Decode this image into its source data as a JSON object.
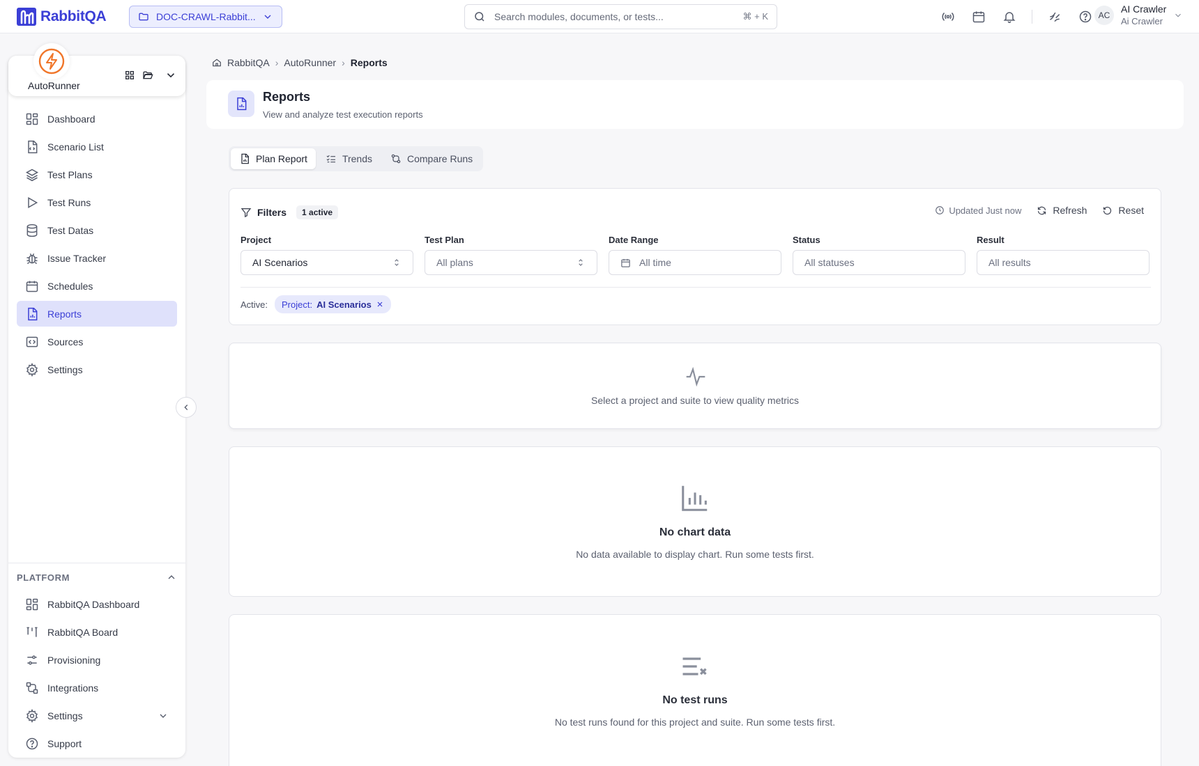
{
  "app": {
    "name": "RabbitQA",
    "brand_color": "#3b3fd6"
  },
  "project_selector": {
    "label": "DOC-CRAWL-Rabbit..."
  },
  "search": {
    "placeholder": "Search modules, documents, or tests...",
    "shortcut": "⌘ + K"
  },
  "topbar_icons": [
    "broadcast-icon",
    "calendar-icon",
    "bell-icon",
    "theme-icon",
    "help-icon"
  ],
  "user": {
    "initials": "AC",
    "name": "AI Crawler",
    "subtitle": "Ai Crawler"
  },
  "module": {
    "name": "AutoRunner",
    "accent_color": "#f0762a"
  },
  "sidebar": {
    "items": [
      {
        "label": "Dashboard",
        "icon": "dashboard-icon"
      },
      {
        "label": "Scenario List",
        "icon": "file-code-icon"
      },
      {
        "label": "Test Plans",
        "icon": "layers-icon"
      },
      {
        "label": "Test Runs",
        "icon": "play-icon"
      },
      {
        "label": "Test Datas",
        "icon": "database-icon"
      },
      {
        "label": "Issue Tracker",
        "icon": "bug-icon"
      },
      {
        "label": "Schedules",
        "icon": "calendar-icon"
      },
      {
        "label": "Reports",
        "icon": "report-icon",
        "active": true
      },
      {
        "label": "Sources",
        "icon": "code-icon"
      },
      {
        "label": "Settings",
        "icon": "gear-icon"
      }
    ]
  },
  "platform": {
    "heading": "PLATFORM",
    "items": [
      {
        "label": "RabbitQA Dashboard",
        "icon": "dashboard-icon"
      },
      {
        "label": "RabbitQA Board",
        "icon": "board-icon"
      },
      {
        "label": "Provisioning",
        "icon": "sliders-icon"
      },
      {
        "label": "Integrations",
        "icon": "integrations-icon"
      },
      {
        "label": "Settings",
        "icon": "gear-icon"
      },
      {
        "label": "Support",
        "icon": "help-icon"
      }
    ]
  },
  "breadcrumb": [
    "RabbitQA",
    "AutoRunner",
    "Reports"
  ],
  "header": {
    "title": "Reports",
    "subtitle": "View and analyze test execution reports"
  },
  "tabs": [
    {
      "label": "Plan Report",
      "active": true
    },
    {
      "label": "Trends"
    },
    {
      "label": "Compare Runs"
    }
  ],
  "filters": {
    "title": "Filters",
    "active_count": "1 active",
    "updated": "Updated Just now",
    "refresh_label": "Refresh",
    "reset_label": "Reset",
    "fields": [
      {
        "label": "Project",
        "value": "AI Scenarios"
      },
      {
        "label": "Test Plan",
        "value": "All plans"
      },
      {
        "label": "Date Range",
        "value": "All time"
      },
      {
        "label": "Status",
        "value": "All statuses"
      },
      {
        "label": "Result",
        "value": "All results"
      }
    ],
    "active_label": "Active:",
    "active_chip": {
      "key": "Project:",
      "value": "AI Scenarios"
    }
  },
  "metrics_empty": {
    "text": "Select a project and suite to view quality metrics"
  },
  "chart_empty": {
    "title": "No chart data",
    "text": "No data available to display chart. Run some tests first."
  },
  "runs_empty": {
    "title": "No test runs",
    "text": "No test runs found for this project and suite. Run some tests first."
  }
}
